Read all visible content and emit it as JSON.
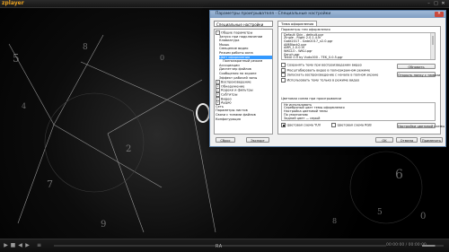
{
  "app": {
    "logo": "zplayer",
    "window_controls": {
      "minimize": "–",
      "maximize": "□",
      "close": "✕"
    }
  },
  "controls": {
    "time": "RA",
    "time_right": "00:00:00 / 00:00:00",
    "play_icon": "▶",
    "stop_icon": "■",
    "prev_icon": "◀",
    "next_icon": "▶",
    "menu_icon": "≡"
  },
  "dialog": {
    "title": "Параметры проигрывателя - Специальные настройки",
    "close_label": "✕",
    "preset_value": "Специальные настройки",
    "tree": [
      {
        "label": "Общие параметры",
        "level": 0,
        "mark": "−",
        "selected": false
      },
      {
        "label": "Запуск при подключении",
        "level": 1,
        "mark": "",
        "selected": false
      },
      {
        "label": "Клавиатура",
        "level": 1,
        "mark": "",
        "selected": false
      },
      {
        "label": "Мышь",
        "level": 1,
        "mark": "",
        "selected": false
      },
      {
        "label": "Смещение видео",
        "level": 1,
        "mark": "",
        "selected": false
      },
      {
        "label": "Режим работы окна",
        "level": 1,
        "mark": "",
        "selected": false
      },
      {
        "label": "Цвет оформления",
        "level": 1,
        "mark": "",
        "selected": true
      },
      {
        "label": "Полноэкранный режим",
        "level": 2,
        "mark": "",
        "selected": false
      },
      {
        "label": "Ассоциации",
        "level": 1,
        "mark": "",
        "selected": false
      },
      {
        "label": "Диспетчер файлов",
        "level": 1,
        "mark": "",
        "selected": false
      },
      {
        "label": "Сообщения на экране",
        "level": 1,
        "mark": "",
        "selected": false
      },
      {
        "label": "Эффект рабочей зоны",
        "level": 1,
        "mark": "",
        "selected": false
      },
      {
        "label": "Воспроизведение",
        "level": 0,
        "mark": "+",
        "selected": false
      },
      {
        "label": "Обнаружение",
        "level": 0,
        "mark": "+",
        "selected": false
      },
      {
        "label": "Кодеки и фильтры",
        "level": 0,
        "mark": "+",
        "selected": false
      },
      {
        "label": "Субтитры",
        "level": 0,
        "mark": "+",
        "selected": false
      },
      {
        "label": "Видео",
        "level": 0,
        "mark": "+",
        "selected": false
      },
      {
        "label": "Аудио",
        "level": 0,
        "mark": "+",
        "selected": false
      },
      {
        "label": "Сеть",
        "level": 0,
        "mark": "",
        "selected": false
      },
      {
        "label": "Параметры листов",
        "level": 0,
        "mark": "",
        "selected": false
      },
      {
        "label": "Связи с типами файлов",
        "level": 0,
        "mark": "",
        "selected": false
      },
      {
        "label": "Конфигурация",
        "level": 0,
        "mark": "",
        "selected": false
      }
    ],
    "tab_label": "Тема оформления",
    "profile_group_label": "Параметры тем оформления",
    "profiles": [
      "Default Skin - default.pgr",
      "Zingle - Right 2.0.1.4.lh",
      "Gate2017 - Gate2017_v2.0.pgr",
      "AIMBlack2.pgr",
      "AMR_1.0.0.lh",
      "WKCLO - WKLI.pgr",
      "Sanch.pgr",
      "TekUI 0.5 by Vudu000 - TEK_0.0.5.pgr"
    ],
    "checkboxes": [
      {
        "label": "Сохранять тему при воспроизведении видео",
        "checked": false
      },
      {
        "label": "Масштабировать видео в полноэкранном режиме",
        "checked": false
      },
      {
        "label": "Запускать воспроизведение с начала в полном экране",
        "checked": false
      },
      {
        "label": "Использовать тему только в режиме видео",
        "checked": false
      }
    ],
    "refresh_button": "Обновить",
    "open_folder_button": "Открыть папку с темами",
    "color_group_label": "Цветовая схема при проигрывании",
    "colors": [
      "Не использовать",
      "Серебряный цвет темы оформления",
      "Настройка цветовой темы",
      "По умолчанию",
      "Задний цвет — серый"
    ],
    "color_checkboxes": [
      {
        "label": "Цветовая схема YUV",
        "checked": true
      },
      {
        "label": "Цветовая схема RGB",
        "checked": false
      }
    ],
    "palette_button": "Настройки цветовой схемы",
    "footer": {
      "reset": "Сброс",
      "export": "Экспорт",
      "ok": "OK",
      "cancel": "Отмена",
      "apply": "Применить"
    }
  }
}
